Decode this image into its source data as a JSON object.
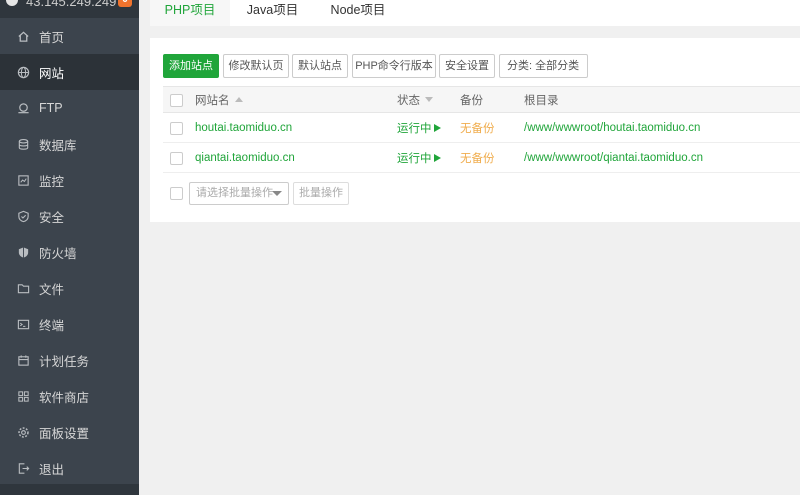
{
  "sidebar": {
    "server_ip": "43.145.249.249",
    "badge": "0",
    "items": [
      {
        "label": "首页",
        "icon": "home-icon"
      },
      {
        "label": "网站",
        "icon": "globe-icon"
      },
      {
        "label": "FTP",
        "icon": "ftp-icon"
      },
      {
        "label": "数据库",
        "icon": "database-icon"
      },
      {
        "label": "监控",
        "icon": "monitor-icon"
      },
      {
        "label": "安全",
        "icon": "shield-icon"
      },
      {
        "label": "防火墙",
        "icon": "firewall-icon"
      },
      {
        "label": "文件",
        "icon": "folder-icon"
      },
      {
        "label": "终端",
        "icon": "terminal-icon"
      },
      {
        "label": "计划任务",
        "icon": "calendar-icon"
      },
      {
        "label": "软件商店",
        "icon": "grid-icon"
      },
      {
        "label": "面板设置",
        "icon": "gear-icon"
      },
      {
        "label": "退出",
        "icon": "logout-icon"
      }
    ],
    "active_index": 1
  },
  "tabs": [
    {
      "label": "PHP项目",
      "active": true
    },
    {
      "label": "Java项目",
      "active": false
    },
    {
      "label": "Node项目",
      "active": false
    }
  ],
  "toolbar": {
    "add_site": "添加站点",
    "edit_default_page": "修改默认页",
    "default_site": "默认站点",
    "php_cli_version": "PHP命令行版本",
    "security_settings": "安全设置",
    "category_filter": "分类: 全部分类"
  },
  "table": {
    "headers": {
      "site_name": "网站名",
      "status": "状态",
      "backup": "备份",
      "root_dir": "根目录"
    },
    "rows": [
      {
        "site_name": "houtai.taomiduo.cn",
        "status": "运行中",
        "backup": "无备份",
        "root_dir": "/www/wwwroot/houtai.taomiduo.cn"
      },
      {
        "site_name": "qiantai.taomiduo.cn",
        "status": "运行中",
        "backup": "无备份",
        "root_dir": "/www/wwwroot/qiantai.taomiduo.cn"
      }
    ]
  },
  "batch": {
    "select_placeholder": "请选择批量操作",
    "button": "批量操作"
  },
  "colors": {
    "accent": "#20a53a",
    "warning": "#f0ad4e",
    "sidebar_bg": "#3c444d"
  }
}
